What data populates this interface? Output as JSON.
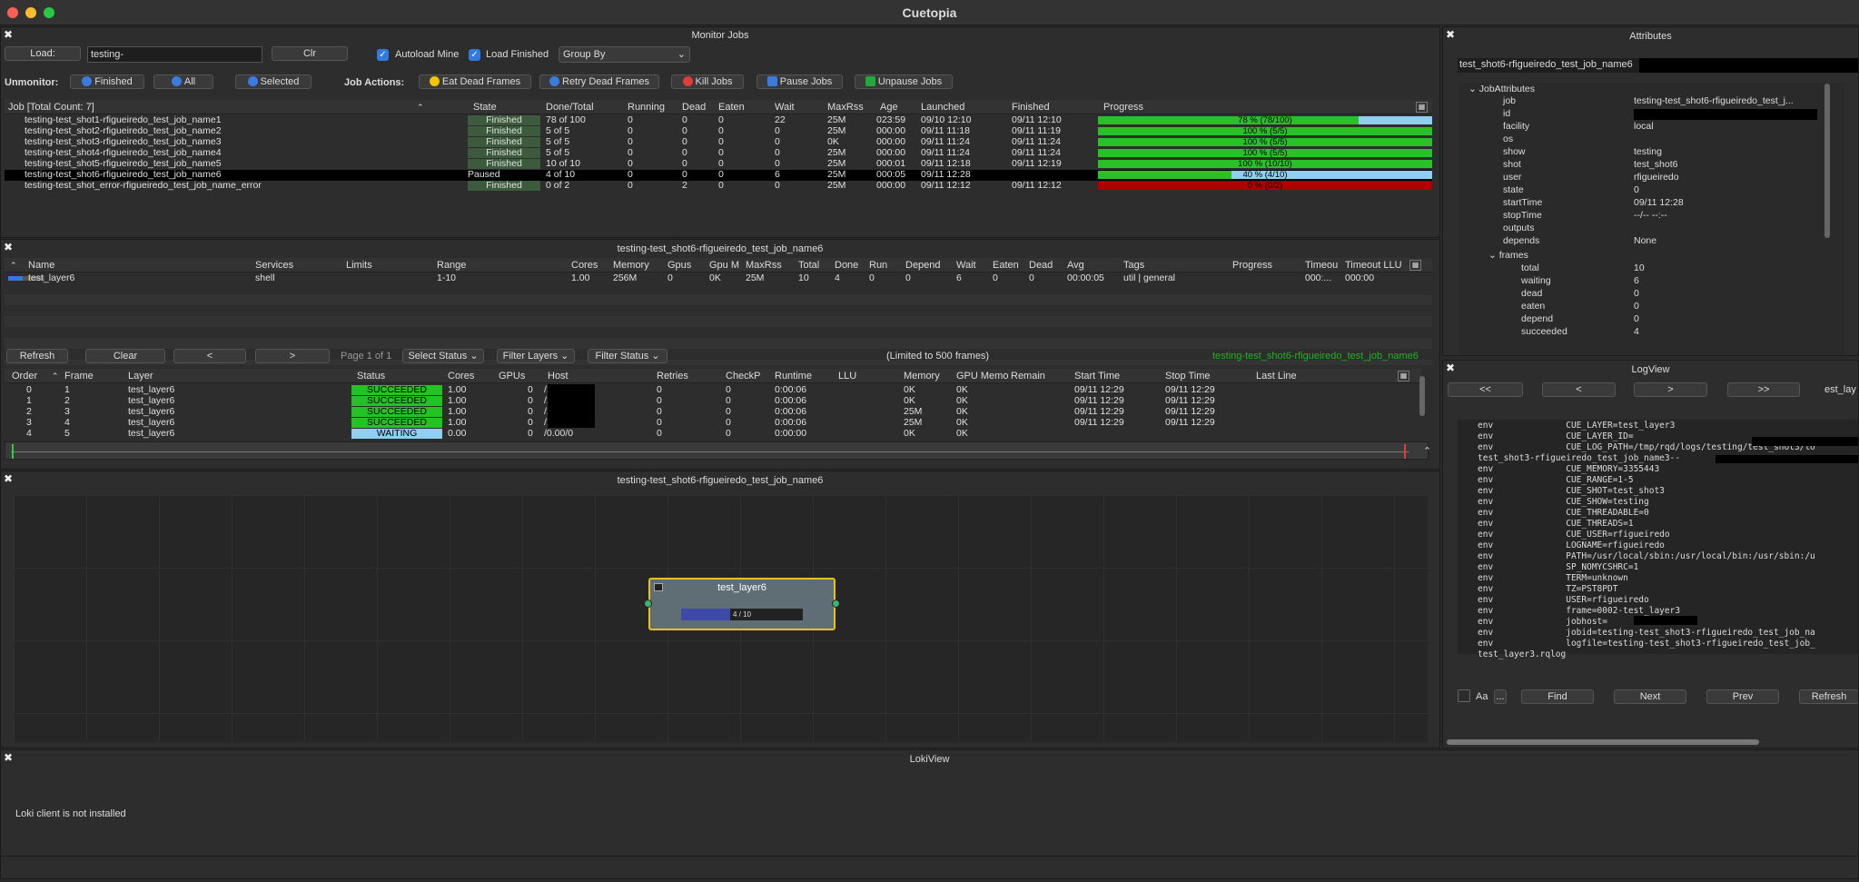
{
  "app": {
    "title": "Cuetopia"
  },
  "monitor": {
    "title": "Monitor Jobs",
    "load_label": "Load:",
    "search_value": "testing-",
    "clr_label": "Clr",
    "autoload_label": "Autoload Mine",
    "loadfinished_label": "Load Finished",
    "groupby_value": "Group By",
    "unmonitor_label": "Unmonitor:",
    "finished_label": "Finished",
    "all_label": "All",
    "selected_label": "Selected",
    "jobactions_label": "Job Actions:",
    "eat_label": "Eat Dead Frames",
    "retry_label": "Retry Dead Frames",
    "kill_label": "Kill Jobs",
    "pause_label": "Pause Jobs",
    "unpause_label": "Unpause Jobs",
    "columns": [
      "Job [Total Count: 7]",
      "State",
      "Done/Total",
      "Running",
      "Dead",
      "Eaten",
      "Wait",
      "MaxRss",
      "Age",
      "Launched",
      "Finished",
      "Progress"
    ],
    "rows": [
      {
        "name": "testing-test_shot1-rfigueiredo_test_job_name1",
        "state": "Finished",
        "done": "78 of 100",
        "running": "0",
        "dead": "0",
        "eaten": "0",
        "wait": "22",
        "maxrss": "25M",
        "age": "023:59",
        "launched": "09/10 12:10",
        "finished": "09/11 12:10",
        "progress": "78 % (78/100)",
        "frac": 0.78,
        "kind": "fin"
      },
      {
        "name": "testing-test_shot2-rfigueiredo_test_job_name2",
        "state": "Finished",
        "done": "5 of 5",
        "running": "0",
        "dead": "0",
        "eaten": "0",
        "wait": "0",
        "maxrss": "25M",
        "age": "000:00",
        "launched": "09/11 11:18",
        "finished": "09/11 11:19",
        "progress": "100 % (5/5)",
        "frac": 1,
        "kind": "fin"
      },
      {
        "name": "testing-test_shot3-rfigueiredo_test_job_name3",
        "state": "Finished",
        "done": "5 of 5",
        "running": "0",
        "dead": "0",
        "eaten": "0",
        "wait": "0",
        "maxrss": "0K",
        "age": "000:00",
        "launched": "09/11 11:24",
        "finished": "09/11 11:24",
        "progress": "100 % (5/5)",
        "frac": 1,
        "kind": "fin"
      },
      {
        "name": "testing-test_shot4-rfigueiredo_test_job_name4",
        "state": "Finished",
        "done": "5 of 5",
        "running": "0",
        "dead": "0",
        "eaten": "0",
        "wait": "0",
        "maxrss": "25M",
        "age": "000:00",
        "launched": "09/11 11:24",
        "finished": "09/11 11:24",
        "progress": "100 % (5/5)",
        "frac": 1,
        "kind": "fin"
      },
      {
        "name": "testing-test_shot5-rfigueiredo_test_job_name5",
        "state": "Finished",
        "done": "10 of 10",
        "running": "0",
        "dead": "0",
        "eaten": "0",
        "wait": "0",
        "maxrss": "25M",
        "age": "000:01",
        "launched": "09/11 12:18",
        "finished": "09/11 12:19",
        "progress": "100 % (10/10)",
        "frac": 1,
        "kind": "fin"
      },
      {
        "name": "testing-test_shot6-rfigueiredo_test_job_name6",
        "state": "Paused",
        "done": "4 of 10",
        "running": "0",
        "dead": "0",
        "eaten": "0",
        "wait": "6",
        "maxrss": "25M",
        "age": "000:05",
        "launched": "09/11 12:28",
        "finished": "",
        "progress": "40 % (4/10)",
        "frac": 0.4,
        "kind": "paused"
      },
      {
        "name": "testing-test_shot_error-rfigueiredo_test_job_name_error",
        "state": "Finished",
        "done": "0 of 2",
        "running": "0",
        "dead": "2",
        "eaten": "0",
        "wait": "0",
        "maxrss": "25M",
        "age": "000:00",
        "launched": "09/11 12:12",
        "finished": "09/11 12:12",
        "progress": "0 % (0/2)",
        "frac": 0,
        "kind": "err"
      }
    ]
  },
  "layers": {
    "title": "testing-test_shot6-rfigueiredo_test_job_name6",
    "columns": [
      "Name",
      "Services",
      "Limits",
      "Range",
      "Cores",
      "Memory",
      "Gpus",
      "Gpu M",
      "MaxRss",
      "Total",
      "Done",
      "Run",
      "Depend",
      "Wait",
      "Eaten",
      "Dead",
      "Avg",
      "Tags",
      "Progress",
      "Timeou",
      "Timeout LLU"
    ],
    "row": {
      "name": "test_layer6",
      "services": "shell",
      "limits": "",
      "range": "1-10",
      "cores": "1.00",
      "memory": "256M",
      "gpus": "0",
      "gpum": "0K",
      "maxrss": "25M",
      "total": "10",
      "done": "4",
      "run": "0",
      "depend": "0",
      "wait": "6",
      "eaten": "0",
      "dead": "0",
      "avg": "00:00:05",
      "tags": "util | general",
      "progress": "",
      "timeout": "000:...",
      "timeoutllu": "000:00"
    }
  },
  "frames": {
    "refresh_label": "Refresh",
    "clear_label": "Clear",
    "prev_label": "<",
    "next_label": ">",
    "page_label": "Page 1 of 1",
    "select_status": "Select Status",
    "filter_layers": "Filter Layers",
    "filter_status": "Filter Status",
    "limit_label": "(Limited to 500 frames)",
    "jobname": "testing-test_shot6-rfigueiredo_test_job_name6",
    "columns": [
      "Order",
      "Frame",
      "Layer",
      "Status",
      "Cores",
      "GPUs",
      "Host",
      "Retries",
      "CheckP",
      "Runtime",
      "LLU",
      "Memory",
      "GPU Memo",
      "Remain",
      "Start Time",
      "Stop Time",
      "Last Line"
    ],
    "rows": [
      {
        "order": "0",
        "frame": "1",
        "layer": "test_layer6",
        "status": "SUCCEEDED",
        "cores": "1.00",
        "gpus": "0",
        "host": "/1.00/0",
        "retries": "0",
        "checkp": "0",
        "runtime": "0:00:06",
        "llu": "",
        "memory": "0K",
        "gpumem": "0K",
        "remain": "",
        "start": "09/11 12:29",
        "stop": "09/11 12:29",
        "last": ""
      },
      {
        "order": "1",
        "frame": "2",
        "layer": "test_layer6",
        "status": "SUCCEEDED",
        "cores": "1.00",
        "gpus": "0",
        "host": "/1.00/0",
        "retries": "0",
        "checkp": "0",
        "runtime": "0:00:06",
        "llu": "",
        "memory": "0K",
        "gpumem": "0K",
        "remain": "",
        "start": "09/11 12:29",
        "stop": "09/11 12:29",
        "last": ""
      },
      {
        "order": "2",
        "frame": "3",
        "layer": "test_layer6",
        "status": "SUCCEEDED",
        "cores": "1.00",
        "gpus": "0",
        "host": "/1.00/0",
        "retries": "0",
        "checkp": "0",
        "runtime": "0:00:06",
        "llu": "",
        "memory": "25M",
        "gpumem": "0K",
        "remain": "",
        "start": "09/11 12:29",
        "stop": "09/11 12:29",
        "last": ""
      },
      {
        "order": "3",
        "frame": "4",
        "layer": "test_layer6",
        "status": "SUCCEEDED",
        "cores": "1.00",
        "gpus": "0",
        "host": "/1.00/0",
        "retries": "0",
        "checkp": "0",
        "runtime": "0:00:06",
        "llu": "",
        "memory": "25M",
        "gpumem": "0K",
        "remain": "",
        "start": "09/11 12:29",
        "stop": "09/11 12:29",
        "last": ""
      },
      {
        "order": "4",
        "frame": "5",
        "layer": "test_layer6",
        "status": "WAITING",
        "cores": "0.00",
        "gpus": "0",
        "host": "/0.00/0",
        "retries": "0",
        "checkp": "0",
        "runtime": "0:00:00",
        "llu": "",
        "memory": "0K",
        "gpumem": "0K",
        "remain": "",
        "start": "",
        "stop": "",
        "last": ""
      }
    ]
  },
  "graph": {
    "title": "testing-test_shot6-rfigueiredo_test_job_name6",
    "node_title": "test_layer6",
    "node_progress": "4 / 10",
    "node_frac": 0.4
  },
  "loki": {
    "title": "LokiView",
    "message": "Loki client is not installed"
  },
  "attributes": {
    "title": "Attributes",
    "job_value": "test_shot6-rfigueiredo_test_job_name6",
    "group": "JobAttributes",
    "items": [
      {
        "key": "job",
        "value": "testing-test_shot6-rfigueiredo_test_j..."
      },
      {
        "key": "id",
        "value": ""
      },
      {
        "key": "facility",
        "value": "local"
      },
      {
        "key": "os",
        "value": ""
      },
      {
        "key": "show",
        "value": "testing"
      },
      {
        "key": "shot",
        "value": "test_shot6"
      },
      {
        "key": "user",
        "value": "rfigueiredo"
      },
      {
        "key": "state",
        "value": "0"
      },
      {
        "key": "startTime",
        "value": "09/11 12:28"
      },
      {
        "key": "stopTime",
        "value": "--/-- --:--"
      },
      {
        "key": "outputs",
        "value": ""
      },
      {
        "key": "depends",
        "value": "None"
      }
    ],
    "frames_group": "frames",
    "frame_items": [
      {
        "key": "total",
        "value": "10"
      },
      {
        "key": "waiting",
        "value": "6"
      },
      {
        "key": "dead",
        "value": "0"
      },
      {
        "key": "eaten",
        "value": "0"
      },
      {
        "key": "depend",
        "value": "0"
      },
      {
        "key": "succeeded",
        "value": "4"
      }
    ]
  },
  "logview": {
    "title": "LogView",
    "first": "<<",
    "prev": "<",
    "next": ">",
    "last": ">>",
    "layer": "est_lay",
    "lines": [
      "env              CUE_LAYER=test_layer3",
      "env              CUE_LAYER_ID=",
      "env              CUE_LOG_PATH=/tmp/rqd/logs/testing/test_shot3/lo",
      "test_shot3-rfigueiredo_test_job_name3--",
      "env              CUE_MEMORY=3355443",
      "env              CUE_RANGE=1-5",
      "env              CUE_SHOT=test_shot3",
      "env              CUE_SHOW=testing",
      "env              CUE_THREADABLE=0",
      "env              CUE_THREADS=1",
      "env              CUE_USER=rfigueiredo",
      "env              LOGNAME=rfigueiredo",
      "env              PATH=/usr/local/sbin:/usr/local/bin:/usr/sbin:/u",
      "env              SP_NOMYCSHRC=1",
      "env              TERM=unknown",
      "env              TZ=PST8PDT",
      "env              USER=rfigueiredo",
      "env              frame=0002-test_layer3",
      "env              jobhost=",
      "env              jobid=testing-test_shot3-rfigueiredo_test_job_na",
      "env              logfile=testing-test_shot3-rfigueiredo_test_job_",
      "test_layer3.rqlog"
    ],
    "aa_label": "Aa",
    "dots_label": "...",
    "find_label": "Find",
    "next_label": "Next",
    "prev_label": "Prev",
    "refresh_label": "Refresh"
  },
  "colors": {
    "green": "#28c228",
    "blue": "#8fd0f2",
    "red": "#b00000",
    "paused_row": "#000000"
  }
}
